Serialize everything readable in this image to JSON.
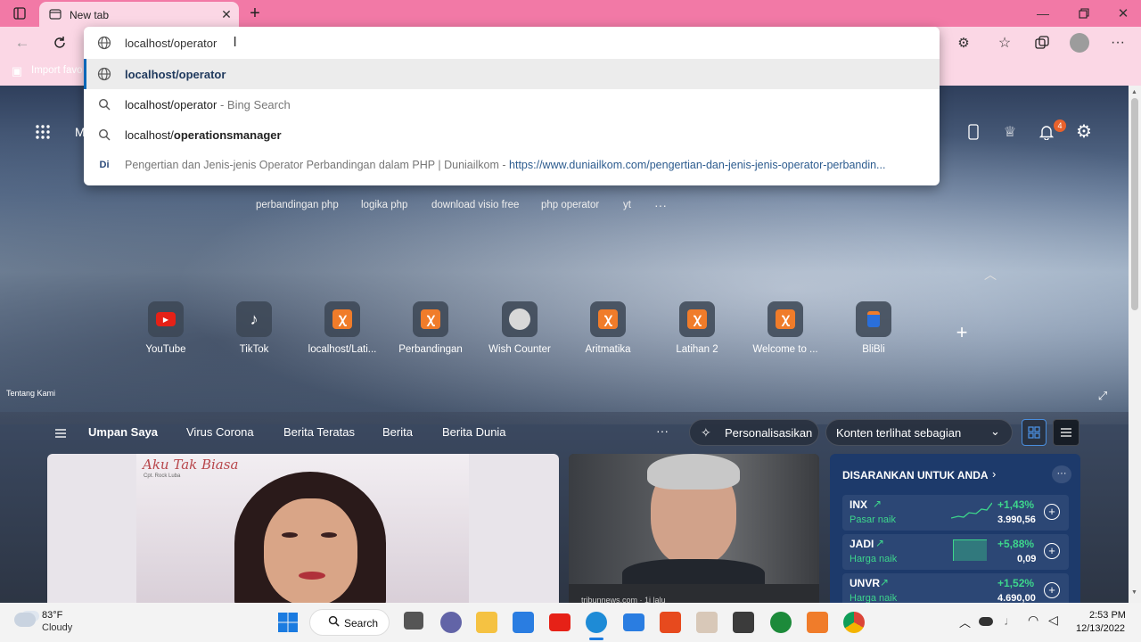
{
  "browser": {
    "tab_title": "New tab",
    "address_value": "localhost/operator",
    "fav_bar_item": "Import favo"
  },
  "suggestions": [
    {
      "icon": "globe-icon",
      "text": "localhost/operator",
      "suffix": ""
    },
    {
      "icon": "search-icon",
      "text": "localhost/operator",
      "suffix": " - Bing Search"
    },
    {
      "icon": "search-icon",
      "prefix": "localhost/",
      "bold": "operationsmanager"
    },
    {
      "icon": "site-favicon",
      "favicon_text": "Di",
      "text": "Pengertian dan Jenis-jenis Operator Perbandingan dalam PHP | Duniailkom - ",
      "url": "https://www.duniailkom.com/pengertian-dan-jenis-jenis-operator-perbandin..."
    }
  ],
  "newtab": {
    "menu_letter": "M",
    "notification_count": "4",
    "chips": [
      "perbandingan php",
      "logika php",
      "download visio free",
      "php operator",
      "yt",
      "···"
    ],
    "shortcuts": [
      "YouTube",
      "TikTok",
      "localhost/Lati...",
      "Perbandingan",
      "Wish Counter",
      "Aritmatika",
      "Latihan 2",
      "Welcome to ...",
      "BliBli"
    ],
    "about_label": "Tentang Kami"
  },
  "feed": {
    "tabs": [
      "Umpan Saya",
      "Virus Corona",
      "Berita Teratas",
      "Berita",
      "Berita Dunia"
    ],
    "more": "···",
    "personalize_label": "Personalisasikan",
    "content_select": "Konten terlihat sebagian",
    "card1_overlay": "Aku Tak Biasa",
    "card1_sub": "Cpt. Rock Luba",
    "card2_source": "tribunnews.com · 1j lalu",
    "stocks_title": "DISARANKAN UNTUK ANDA",
    "stocks": [
      {
        "symbol": "INX",
        "desc": "Pasar naik",
        "change": "+1,43%",
        "price": "3.990,56"
      },
      {
        "symbol": "JADI",
        "desc": "Harga naik",
        "change": "+5,88%",
        "price": "0,09"
      },
      {
        "symbol": "UNVR",
        "desc": "Harga naik",
        "change": "+1,52%",
        "price": "4.690,00"
      }
    ]
  },
  "taskbar": {
    "temp": "83°F",
    "weather": "Cloudy",
    "search_label": "Search",
    "time": "2:53 PM",
    "date": "12/13/2022"
  },
  "colors": {
    "tabstrip": "#f279a6",
    "toolbar": "#fbd7e5",
    "stock_green": "#3dd68c"
  }
}
